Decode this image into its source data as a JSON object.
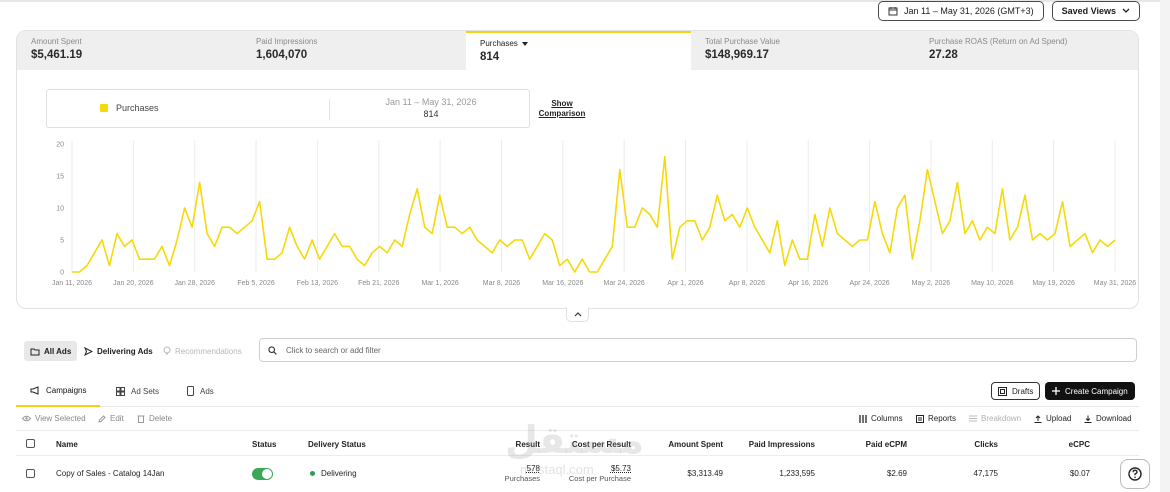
{
  "date_range": "Jan 11 – May 31, 2026 (GMT+3)",
  "saved_views": "Saved Views",
  "metrics": [
    {
      "label": "Amount Spent",
      "value": "$5,461.19"
    },
    {
      "label": "Paid Impressions",
      "value": "1,604,070"
    },
    {
      "label": "Purchases",
      "value": "814"
    },
    {
      "label": "Total Purchase Value",
      "value": "$148,969.17"
    },
    {
      "label": "Purchase ROAS (Return on Ad Spend)",
      "value": "27.28"
    }
  ],
  "legend": {
    "series": "Purchases",
    "range": "Jan 11 – May 31, 2026",
    "count": "814",
    "show_comparison": "Show Comparison"
  },
  "chart_data": {
    "type": "line",
    "series": [
      {
        "name": "Purchases",
        "color": "#f5d90a",
        "values": [
          0,
          0,
          1,
          3,
          5,
          1,
          6,
          4,
          5,
          2,
          2,
          2,
          4,
          1,
          5,
          10,
          7,
          14,
          6,
          4,
          7,
          7,
          6,
          7,
          8,
          11,
          2,
          2,
          3,
          7,
          4,
          2,
          5,
          2,
          4,
          6,
          4,
          4,
          2,
          1,
          3,
          4,
          3,
          5,
          4,
          9,
          13,
          7,
          6,
          12,
          7,
          7,
          6,
          7,
          5,
          4,
          3,
          5,
          4,
          5,
          5,
          2,
          4,
          6,
          5,
          1,
          2,
          0,
          2,
          0,
          0,
          2,
          4,
          16,
          7,
          7,
          10,
          9,
          7,
          18,
          2,
          7,
          8,
          8,
          5,
          7,
          12,
          8,
          9,
          7,
          10,
          7,
          5,
          3,
          8,
          1,
          5,
          2,
          2,
          9,
          4,
          10,
          6,
          5,
          4,
          5,
          5,
          11,
          6,
          3,
          10,
          12,
          2,
          8,
          16,
          11,
          6,
          8,
          14,
          6,
          8,
          5,
          7,
          6,
          13,
          5,
          7,
          12,
          5,
          6,
          5,
          6,
          11,
          4,
          5,
          6,
          3,
          5,
          4,
          5
        ]
      }
    ],
    "x_tick_labels": [
      "Jan 11, 2026",
      "Jan 20, 2026",
      "Jan 28, 2026",
      "Feb 5, 2026",
      "Feb 13, 2026",
      "Feb 21, 2026",
      "Mar 1, 2026",
      "Mar 8, 2026",
      "Mar 16, 2026",
      "Mar 24, 2026",
      "Apr 1, 2026",
      "Apr 8, 2026",
      "Apr 16, 2026",
      "Apr 24, 2026",
      "May 2, 2026",
      "May 10, 2026",
      "May 19, 2026",
      "May 31, 2026"
    ],
    "y_ticks": [
      0,
      5,
      10,
      15,
      20
    ],
    "ylim": [
      0,
      20
    ],
    "grid": "vertical"
  },
  "filter_tabs": {
    "all_ads": "All Ads",
    "delivering_ads": "Delivering Ads",
    "recommendations": "Recommendations"
  },
  "search_placeholder": "Click to search or add filter",
  "table_tabs": {
    "campaigns": "Campaigns",
    "ad_sets": "Ad Sets",
    "ads": "Ads"
  },
  "buttons": {
    "drafts": "Drafts",
    "create_campaign": "Create Campaign"
  },
  "actions": {
    "view_selected": "View Selected",
    "edit": "Edit",
    "delete": "Delete",
    "columns": "Columns",
    "reports": "Reports",
    "breakdown": "Breakdown",
    "upload": "Upload",
    "download": "Download"
  },
  "columns": {
    "name": "Name",
    "status": "Status",
    "delivery_status": "Delivery Status",
    "result": "Result",
    "cost_per_result": "Cost per Result",
    "amount_spent": "Amount Spent",
    "paid_impressions": "Paid Impressions",
    "paid_ecpm": "Paid eCPM",
    "clicks": "Clicks",
    "ecpc": "eCPC"
  },
  "rows": [
    {
      "name": "Copy of Sales - Catalog 14Jan",
      "delivery": "Delivering",
      "result": "578",
      "result_unit": "Purchases",
      "cost": "$5.73",
      "cost_unit": "Cost per Purchase",
      "amount": "$3,313.49",
      "impressions": "1,233,595",
      "ecpm": "$2.69",
      "clicks": "47,175",
      "ecpc": "$0.07"
    }
  ],
  "watermark": {
    "text": "مستقل",
    "sub": "mostaql.com"
  }
}
